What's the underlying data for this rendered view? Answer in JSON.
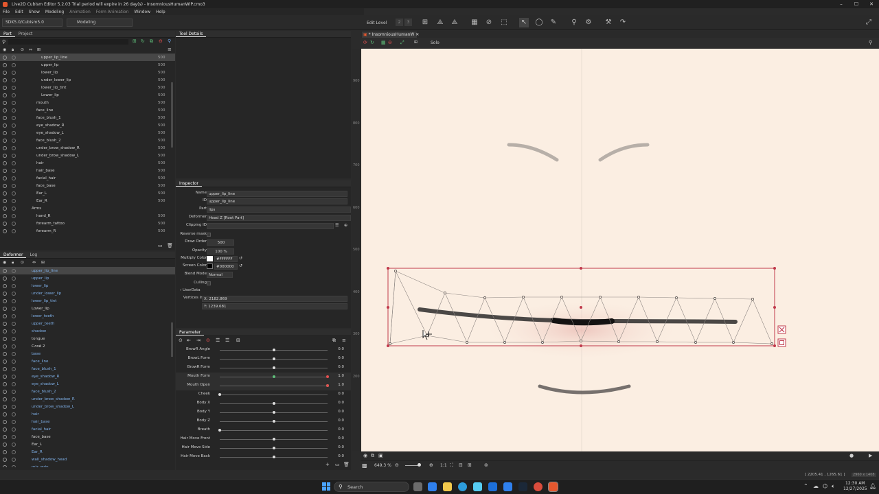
{
  "app": {
    "title": "Live2D Cubism Editor 5.2.03   Trial period will expire in 26 day(s)   - InsomniousHumanWIP.cmo3",
    "menus": [
      "File",
      "Edit",
      "Show",
      "Modeling",
      "Animation",
      "Form Animation",
      "Window",
      "Help"
    ],
    "sdk": "SDK5.0/Cubism5.0",
    "mode": "Modeling",
    "edit_level_label": "Edit Level",
    "edit_level_2": "2",
    "edit_level_3": "3"
  },
  "parts_panel": {
    "tabs": [
      "Part",
      "Project"
    ],
    "rows": [
      {
        "name": "upper_lip_line",
        "value": "500",
        "indent": 60,
        "selected": true
      },
      {
        "name": "upper_lip",
        "value": "500",
        "indent": 60
      },
      {
        "name": "lower_lip",
        "value": "500",
        "indent": 60
      },
      {
        "name": "under_lower_lip",
        "value": "500",
        "indent": 60
      },
      {
        "name": "lower_lip_tint",
        "value": "500",
        "indent": 60
      },
      {
        "name": "Lower_lip",
        "value": "500",
        "indent": 60
      },
      {
        "name": "mouth",
        "value": "500",
        "indent": 53
      },
      {
        "name": "face_line",
        "value": "500",
        "indent": 53
      },
      {
        "name": "face_blush_1",
        "value": "500",
        "indent": 53
      },
      {
        "name": "eye_shadow_R",
        "value": "500",
        "indent": 53
      },
      {
        "name": "eye_shadow_L",
        "value": "500",
        "indent": 53
      },
      {
        "name": "face_blush_2",
        "value": "500",
        "indent": 53
      },
      {
        "name": "under_brow_shadow_R",
        "value": "500",
        "indent": 53
      },
      {
        "name": "under_brow_shadow_L",
        "value": "500",
        "indent": 53
      },
      {
        "name": "hair",
        "value": "500",
        "indent": 53
      },
      {
        "name": "hair_base",
        "value": "500",
        "indent": 53
      },
      {
        "name": "facial_hair",
        "value": "500",
        "indent": 53
      },
      {
        "name": "face_base",
        "value": "500",
        "indent": 53
      },
      {
        "name": "Ear_L",
        "value": "500",
        "indent": 53
      },
      {
        "name": "Ear_R",
        "value": "500",
        "indent": 53
      },
      {
        "name": "Arms",
        "value": "",
        "indent": 46
      },
      {
        "name": "hand_R",
        "value": "500",
        "indent": 53
      },
      {
        "name": "forearm_tattoo",
        "value": "500",
        "indent": 53
      },
      {
        "name": "forearm_R",
        "value": "500",
        "indent": 53
      }
    ]
  },
  "tool_details": {
    "title": "Tool Details"
  },
  "deformer_panel": {
    "tabs": [
      "Deformer",
      "Log"
    ],
    "rows": [
      {
        "name": "upper_lip_line",
        "selected": true,
        "blue": true
      },
      {
        "name": "upper_lip",
        "blue": true
      },
      {
        "name": "lower_lip",
        "blue": true
      },
      {
        "name": "under_lower_lip",
        "blue": true
      },
      {
        "name": "lower_lip_tint",
        "blue": true
      },
      {
        "name": "Lower_lip",
        "blue": false
      },
      {
        "name": "lower_teeth",
        "blue": true
      },
      {
        "name": "upper_teeth",
        "blue": true
      },
      {
        "name": "shadow",
        "blue": true
      },
      {
        "name": "tongue",
        "blue": false
      },
      {
        "name": "Слой 2",
        "blue": false
      },
      {
        "name": "base",
        "blue": true
      },
      {
        "name": "face_line",
        "blue": true
      },
      {
        "name": "face_blush_1",
        "blue": true
      },
      {
        "name": "eye_shadow_R",
        "blue": true
      },
      {
        "name": "eye_shadow_L",
        "blue": true
      },
      {
        "name": "face_blush_2",
        "blue": true
      },
      {
        "name": "under_brow_shadow_R",
        "blue": true
      },
      {
        "name": "under_brow_shadow_L",
        "blue": true
      },
      {
        "name": "hair",
        "blue": true
      },
      {
        "name": "hair_base",
        "blue": true
      },
      {
        "name": "facial_hair",
        "blue": true
      },
      {
        "name": "face_base",
        "blue": false
      },
      {
        "name": "Ear_L",
        "blue": false
      },
      {
        "name": "Ear_R",
        "blue": true
      },
      {
        "name": "wall_shadow_head",
        "blue": true
      },
      {
        "name": "mix_wrin",
        "blue": true
      }
    ]
  },
  "inspector": {
    "title": "Inspector",
    "name_label": "Name",
    "name_value": "upper_lip_line",
    "id_label": "ID",
    "id_value": "upper_lip_line",
    "part_label": "Part",
    "part_value": "lips",
    "deformer_label": "Deformer",
    "deformer_value": "Head Z  [Root Part]",
    "clipping_label": "Clipping ID",
    "reverse_label": "Reverse mask",
    "draw_order_label": "Draw Order",
    "draw_order_value": "500",
    "opacity_label": "Opacity",
    "opacity_value": "100 %",
    "multiply_label": "Multiply Color",
    "multiply_value": "#FFFFFF",
    "screen_label": "Screen Color",
    "screen_value": "#000000",
    "blend_label": "Blend Mode",
    "blend_value": "Normal",
    "culling_label": "Culling",
    "userdata_label": "UserData",
    "vertices_label": "Vertices Info",
    "vx": "X: 2182.869",
    "vy": "Y: 1239.681"
  },
  "parameter": {
    "title": "Parameter",
    "items": [
      {
        "name": "BrowR Angle",
        "value": "0.0",
        "pos": 0.5
      },
      {
        "name": "BrowL Form",
        "value": "0.0",
        "pos": 0.5
      },
      {
        "name": "BrowR Form",
        "value": "0.0",
        "pos": 0.5
      },
      {
        "name": "Mouth Form",
        "value": "1.0",
        "pos": 0.5,
        "active": true
      },
      {
        "name": "Mouth Open",
        "value": "1.0",
        "pos": 1.0,
        "active": true
      },
      {
        "name": "Cheek",
        "value": "0.0",
        "pos": 0.0
      },
      {
        "name": "Body X",
        "value": "0.0",
        "pos": 0.5
      },
      {
        "name": "Body Y",
        "value": "0.0",
        "pos": 0.5
      },
      {
        "name": "Body Z",
        "value": "0.0",
        "pos": 0.5
      },
      {
        "name": "Breath",
        "value": "0.0",
        "pos": 0.0
      },
      {
        "name": "Hair Move Front",
        "value": "0.0",
        "pos": 0.5
      },
      {
        "name": "Hair Move Side",
        "value": "0.0",
        "pos": 0.5
      },
      {
        "name": "Hair Move Back",
        "value": "0.0",
        "pos": 0.5
      }
    ]
  },
  "viewport": {
    "tab": "* InsomniousHumanW",
    "solo": "Solo",
    "zoom": "649.3 %",
    "ratio": "1:1",
    "coords": "[ 2205.41 , 1265.61 ]",
    "canvas_size": "2960 x 1408"
  },
  "ruler_labels": [
    "900",
    "800",
    "700",
    "600",
    "500",
    "400",
    "300",
    "200"
  ],
  "taskbar": {
    "search": "Search",
    "time": "12:30 AM",
    "date": "12/27/2025"
  },
  "colors": {
    "accent": "#e04a4a",
    "selection": "#c0394b",
    "canvas": "#fbeee2"
  }
}
